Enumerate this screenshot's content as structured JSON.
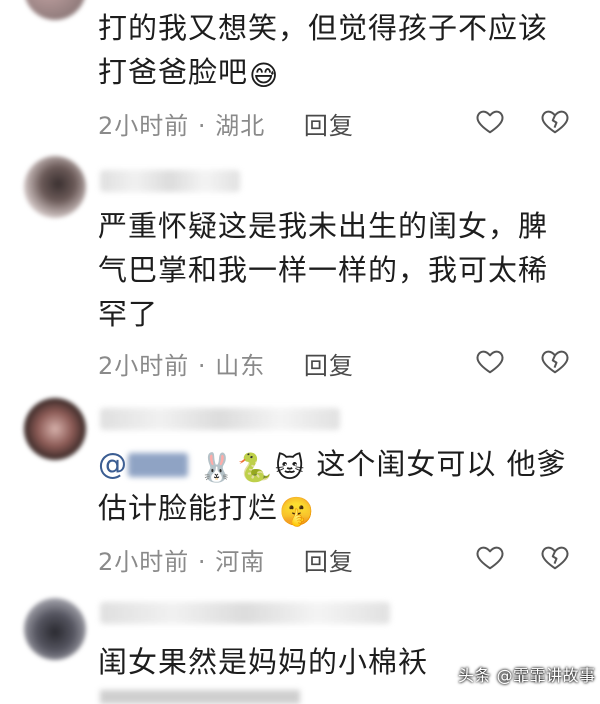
{
  "comments": [
    {
      "text_line1": "打的我又想笑，但觉得孩子不应该",
      "text_line2": "打爸爸脸吧",
      "emoji": "😅",
      "time": "2小时前",
      "location": "湖北",
      "reply_label": "回复"
    },
    {
      "text_line1": "严重怀疑这是我未出生的闺女，脾",
      "text_line2": "气巴掌和我一样一样的，我可太稀",
      "text_line3": "罕了",
      "time": "2小时前",
      "location": "山东",
      "reply_label": "回复"
    },
    {
      "mention": "@",
      "emojis": [
        "🐰",
        "🐍",
        "🐱"
      ],
      "text_line1": "这个闺女可以 他爹",
      "text_line2": "估计脸能打烂",
      "emoji": "🤫",
      "time": "2小时前",
      "location": "河南",
      "reply_label": "回复"
    },
    {
      "text_line1": "闺女果然是妈妈的小棉袄"
    }
  ],
  "meta_separator": "·",
  "watermark": {
    "label": "头条 @霏霏讲故事"
  },
  "colors": {
    "meta_gray": "#8a8a8a",
    "mention_blue": "#3b5d92"
  }
}
